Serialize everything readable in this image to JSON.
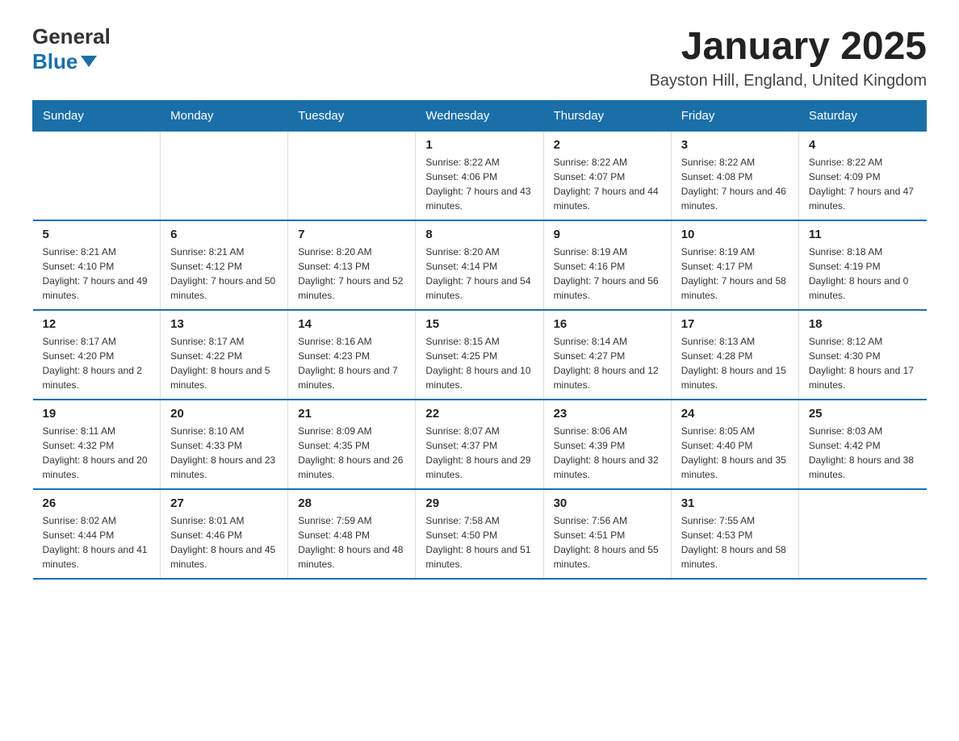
{
  "logo": {
    "general": "General",
    "blue": "Blue"
  },
  "title": "January 2025",
  "subtitle": "Bayston Hill, England, United Kingdom",
  "headers": [
    "Sunday",
    "Monday",
    "Tuesday",
    "Wednesday",
    "Thursday",
    "Friday",
    "Saturday"
  ],
  "weeks": [
    [
      {
        "day": "",
        "info": ""
      },
      {
        "day": "",
        "info": ""
      },
      {
        "day": "",
        "info": ""
      },
      {
        "day": "1",
        "info": "Sunrise: 8:22 AM\nSunset: 4:06 PM\nDaylight: 7 hours and 43 minutes."
      },
      {
        "day": "2",
        "info": "Sunrise: 8:22 AM\nSunset: 4:07 PM\nDaylight: 7 hours and 44 minutes."
      },
      {
        "day": "3",
        "info": "Sunrise: 8:22 AM\nSunset: 4:08 PM\nDaylight: 7 hours and 46 minutes."
      },
      {
        "day": "4",
        "info": "Sunrise: 8:22 AM\nSunset: 4:09 PM\nDaylight: 7 hours and 47 minutes."
      }
    ],
    [
      {
        "day": "5",
        "info": "Sunrise: 8:21 AM\nSunset: 4:10 PM\nDaylight: 7 hours and 49 minutes."
      },
      {
        "day": "6",
        "info": "Sunrise: 8:21 AM\nSunset: 4:12 PM\nDaylight: 7 hours and 50 minutes."
      },
      {
        "day": "7",
        "info": "Sunrise: 8:20 AM\nSunset: 4:13 PM\nDaylight: 7 hours and 52 minutes."
      },
      {
        "day": "8",
        "info": "Sunrise: 8:20 AM\nSunset: 4:14 PM\nDaylight: 7 hours and 54 minutes."
      },
      {
        "day": "9",
        "info": "Sunrise: 8:19 AM\nSunset: 4:16 PM\nDaylight: 7 hours and 56 minutes."
      },
      {
        "day": "10",
        "info": "Sunrise: 8:19 AM\nSunset: 4:17 PM\nDaylight: 7 hours and 58 minutes."
      },
      {
        "day": "11",
        "info": "Sunrise: 8:18 AM\nSunset: 4:19 PM\nDaylight: 8 hours and 0 minutes."
      }
    ],
    [
      {
        "day": "12",
        "info": "Sunrise: 8:17 AM\nSunset: 4:20 PM\nDaylight: 8 hours and 2 minutes."
      },
      {
        "day": "13",
        "info": "Sunrise: 8:17 AM\nSunset: 4:22 PM\nDaylight: 8 hours and 5 minutes."
      },
      {
        "day": "14",
        "info": "Sunrise: 8:16 AM\nSunset: 4:23 PM\nDaylight: 8 hours and 7 minutes."
      },
      {
        "day": "15",
        "info": "Sunrise: 8:15 AM\nSunset: 4:25 PM\nDaylight: 8 hours and 10 minutes."
      },
      {
        "day": "16",
        "info": "Sunrise: 8:14 AM\nSunset: 4:27 PM\nDaylight: 8 hours and 12 minutes."
      },
      {
        "day": "17",
        "info": "Sunrise: 8:13 AM\nSunset: 4:28 PM\nDaylight: 8 hours and 15 minutes."
      },
      {
        "day": "18",
        "info": "Sunrise: 8:12 AM\nSunset: 4:30 PM\nDaylight: 8 hours and 17 minutes."
      }
    ],
    [
      {
        "day": "19",
        "info": "Sunrise: 8:11 AM\nSunset: 4:32 PM\nDaylight: 8 hours and 20 minutes."
      },
      {
        "day": "20",
        "info": "Sunrise: 8:10 AM\nSunset: 4:33 PM\nDaylight: 8 hours and 23 minutes."
      },
      {
        "day": "21",
        "info": "Sunrise: 8:09 AM\nSunset: 4:35 PM\nDaylight: 8 hours and 26 minutes."
      },
      {
        "day": "22",
        "info": "Sunrise: 8:07 AM\nSunset: 4:37 PM\nDaylight: 8 hours and 29 minutes."
      },
      {
        "day": "23",
        "info": "Sunrise: 8:06 AM\nSunset: 4:39 PM\nDaylight: 8 hours and 32 minutes."
      },
      {
        "day": "24",
        "info": "Sunrise: 8:05 AM\nSunset: 4:40 PM\nDaylight: 8 hours and 35 minutes."
      },
      {
        "day": "25",
        "info": "Sunrise: 8:03 AM\nSunset: 4:42 PM\nDaylight: 8 hours and 38 minutes."
      }
    ],
    [
      {
        "day": "26",
        "info": "Sunrise: 8:02 AM\nSunset: 4:44 PM\nDaylight: 8 hours and 41 minutes."
      },
      {
        "day": "27",
        "info": "Sunrise: 8:01 AM\nSunset: 4:46 PM\nDaylight: 8 hours and 45 minutes."
      },
      {
        "day": "28",
        "info": "Sunrise: 7:59 AM\nSunset: 4:48 PM\nDaylight: 8 hours and 48 minutes."
      },
      {
        "day": "29",
        "info": "Sunrise: 7:58 AM\nSunset: 4:50 PM\nDaylight: 8 hours and 51 minutes."
      },
      {
        "day": "30",
        "info": "Sunrise: 7:56 AM\nSunset: 4:51 PM\nDaylight: 8 hours and 55 minutes."
      },
      {
        "day": "31",
        "info": "Sunrise: 7:55 AM\nSunset: 4:53 PM\nDaylight: 8 hours and 58 minutes."
      },
      {
        "day": "",
        "info": ""
      }
    ]
  ]
}
